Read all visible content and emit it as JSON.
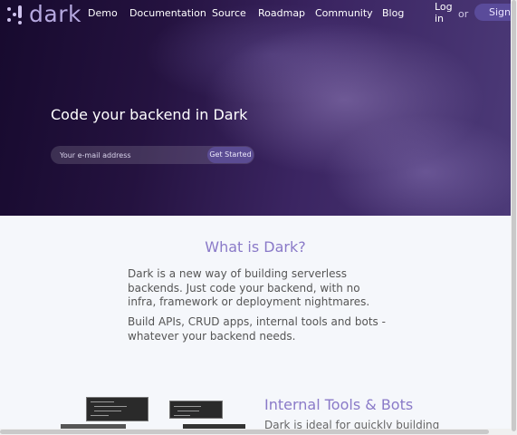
{
  "brand": {
    "name": "dark"
  },
  "nav": {
    "links": [
      "Demo",
      "Documentation",
      "Source",
      "Roadmap",
      "Community",
      "Blog"
    ],
    "login": "Log in",
    "or": "or",
    "signup": "Signup"
  },
  "hero": {
    "tagline": "Code your backend in Dark",
    "email_placeholder": "Your e-mail address",
    "cta": "Get Started"
  },
  "about": {
    "title": "What is Dark?",
    "paragraph1": "Dark is a new way of building serverless backends. Just code your backend, with no infra, framework or deployment nightmares.",
    "paragraph2": "Build APIs, CRUD apps, internal tools and bots - whatever your backend needs."
  },
  "features": {
    "title": "Internal Tools & Bots",
    "subtitle": "Dark is ideal for quickly building"
  },
  "colors": {
    "accent": "#8a7ac8",
    "hero_dark": "#170a2e",
    "button": "#5b4c93"
  }
}
